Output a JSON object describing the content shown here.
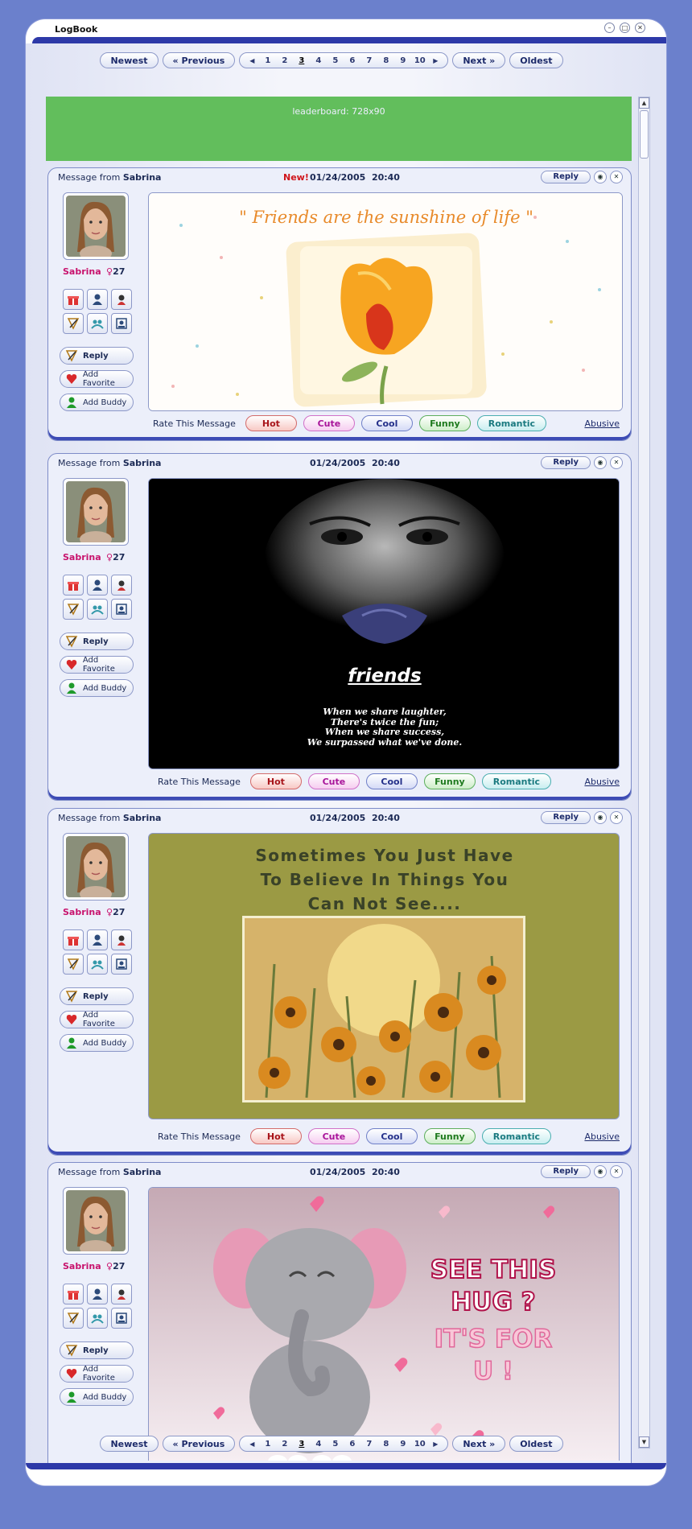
{
  "window": {
    "title": "LogBook"
  },
  "ad": {
    "label": "leaderboard: 728x90"
  },
  "pager": {
    "newest": "Newest",
    "previous": "« Previous",
    "next": "Next »",
    "oldest": "Oldest",
    "pages": [
      "1",
      "2",
      "3",
      "4",
      "5",
      "6",
      "7",
      "8",
      "9",
      "10"
    ],
    "current_page": "3"
  },
  "rating": {
    "label": "Rate  This Message",
    "buttons": [
      "Hot",
      "Cute",
      "Cool",
      "Funny",
      "Romantic"
    ],
    "abusive": "Abusive"
  },
  "labels": {
    "message_from": "Message from",
    "new": "New!",
    "reply": "Reply",
    "add_favorite": "Add Favorite",
    "add_buddy": "Add Buddy"
  },
  "messages": [
    {
      "sender": "Sabrina",
      "age": "27",
      "is_new": true,
      "date": "01/24/2005",
      "time": "20:40",
      "card": {
        "theme": "tulip",
        "title": "\" Friends are the sunshine of life \""
      }
    },
    {
      "sender": "Sabrina",
      "age": "27",
      "is_new": false,
      "date": "01/24/2005",
      "time": "20:40",
      "card": {
        "theme": "friends",
        "title": "friends",
        "lines": [
          "When we share laughter,",
          "There's twice the fun;",
          "When we share success,",
          "We surpassed what we've done."
        ]
      }
    },
    {
      "sender": "Sabrina",
      "age": "27",
      "is_new": false,
      "date": "01/24/2005",
      "time": "20:40",
      "card": {
        "theme": "believe",
        "lines": [
          "Sometimes You Just Have",
          "To Believe In Things You",
          "Can Not See...."
        ]
      }
    },
    {
      "sender": "Sabrina",
      "age": "27",
      "is_new": false,
      "date": "01/24/2005",
      "time": "20:40",
      "card": {
        "theme": "hug",
        "lines": [
          "SEE THIS",
          "HUG ?",
          "IT'S FOR",
          "U !"
        ]
      }
    }
  ],
  "colors": {
    "background": "#6b80cc",
    "window_bar": "#2d39a8",
    "ad": "#62be5c",
    "name": "#c8136d",
    "new": "#d0151b"
  }
}
